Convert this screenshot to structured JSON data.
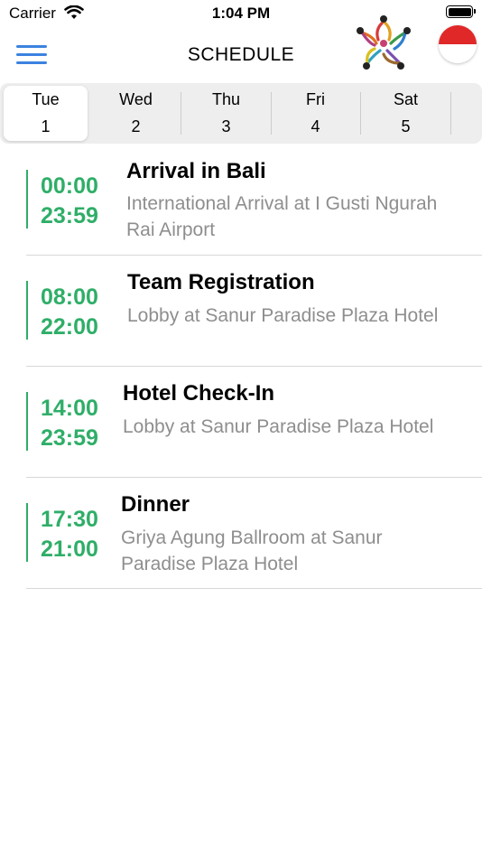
{
  "status_bar": {
    "carrier": "Carrier",
    "time": "1:04 PM"
  },
  "nav": {
    "title": "SCHEDULE",
    "accent": "#3b82e0"
  },
  "days": [
    {
      "name": "Tue",
      "num": "1",
      "selected": true
    },
    {
      "name": "Wed",
      "num": "2"
    },
    {
      "name": "Thu",
      "num": "3"
    },
    {
      "name": "Fri",
      "num": "4"
    },
    {
      "name": "Sat",
      "num": "5"
    }
  ],
  "time_color": "#2fae68",
  "events": [
    {
      "start": "00:00",
      "end": "23:59",
      "title": "Arrival in Bali",
      "location": "International Arrival at I Gusti Ngurah Rai Airport"
    },
    {
      "start": "08:00",
      "end": "22:00",
      "title": "Team Registration",
      "location": "Lobby at Sanur Paradise Plaza Hotel"
    },
    {
      "start": "14:00",
      "end": "23:59",
      "title": "Hotel Check-In",
      "location": "Lobby at Sanur Paradise Plaza Hotel"
    },
    {
      "start": "17:30",
      "end": "21:00",
      "title": "Dinner",
      "location": "Griya Agung Ballroom at Sanur Paradise Plaza Hotel"
    }
  ]
}
